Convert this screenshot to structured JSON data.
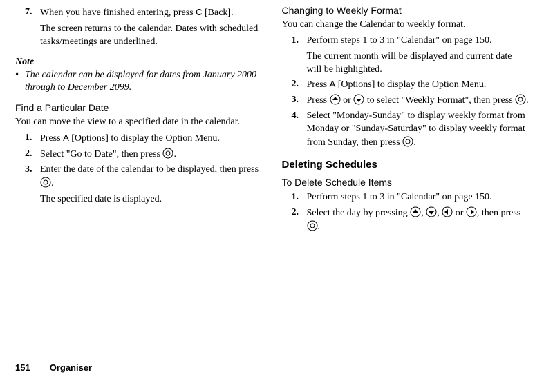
{
  "footer": {
    "page": "151",
    "section": "Organiser"
  },
  "left": {
    "step7": {
      "num": "7.",
      "prefix": "When you have finished entering, press ",
      "key": "C",
      "suffix": " [Back].",
      "sub": "The screen returns to the calendar. Dates with scheduled tasks/meetings are underlined."
    },
    "note": {
      "head": "Note",
      "bullet": "•",
      "text": "The calendar can be displayed for dates from January 2000 through to December 2099."
    },
    "find": {
      "head": "Find a Particular Date",
      "intro": "You can move the view to a specified date in the calendar.",
      "s1": {
        "num": "1.",
        "pre": "Press ",
        "key": "A",
        "post": " [Options] to display the Option Menu."
      },
      "s2": {
        "num": "2.",
        "pre": "Select \"Go to Date\", then press ",
        "post": "."
      },
      "s3": {
        "num": "3.",
        "pre": "Enter the date of the calendar to be displayed, then press ",
        "post": ".",
        "sub": "The specified date is displayed."
      }
    }
  },
  "right": {
    "weekly": {
      "head": "Changing to Weekly Format",
      "intro": "You can change the Calendar to weekly format.",
      "s1": {
        "num": "1.",
        "text": "Perform steps 1 to 3 in \"Calendar\" on page 150.",
        "sub": "The current month will be displayed and current date will be highlighted."
      },
      "s2": {
        "num": "2.",
        "pre": "Press ",
        "key": "A",
        "post": " [Options] to display the Option Menu."
      },
      "s3": {
        "num": "3.",
        "pre": "Press ",
        "mid": " or ",
        "post1": " to select \"Weekly Format\", then press ",
        "post2": "."
      },
      "s4": {
        "num": "4.",
        "pre": "Select \"Monday-Sunday\" to display weekly format from Monday or \"Sunday-Saturday\" to display weekly format from Sunday, then press ",
        "post": "."
      }
    },
    "del": {
      "head": "Deleting Schedules",
      "sub": "To Delete Schedule Items",
      "s1": {
        "num": "1.",
        "text": "Perform steps 1 to 3 in \"Calendar\" on page 150."
      },
      "s2": {
        "num": "2.",
        "pre": "Select the day by pressing ",
        "c1": ", ",
        "c2": ", ",
        "c3": " or ",
        "post1": ", then press ",
        "post2": "."
      }
    }
  }
}
